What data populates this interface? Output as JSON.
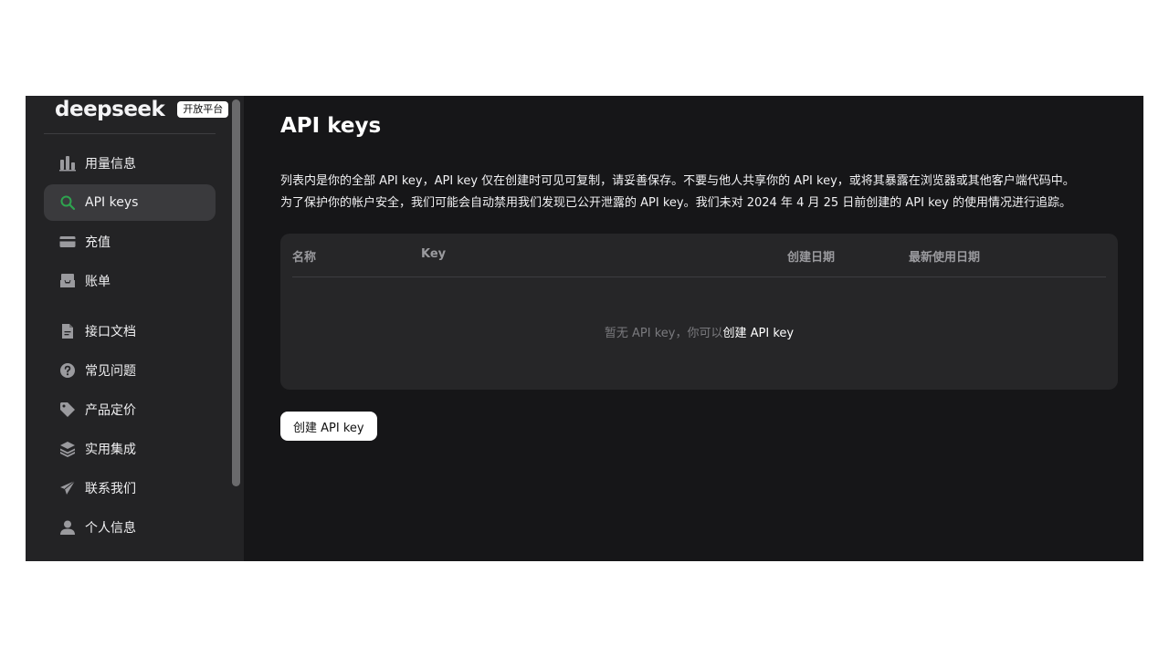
{
  "brand": {
    "logo": "deepseek",
    "badge": "开放平台"
  },
  "sidebar": {
    "items": [
      {
        "label": "用量信息",
        "icon": "bar-chart-icon"
      },
      {
        "label": "API keys",
        "icon": "search-icon",
        "active": true
      },
      {
        "label": "充值",
        "icon": "credit-card-icon"
      },
      {
        "label": "账单",
        "icon": "inbox-icon"
      },
      {
        "label": "接口文档",
        "icon": "document-icon"
      },
      {
        "label": "常见问题",
        "icon": "question-icon"
      },
      {
        "label": "产品定价",
        "icon": "tag-icon"
      },
      {
        "label": "实用集成",
        "icon": "layers-icon"
      },
      {
        "label": "联系我们",
        "icon": "send-icon"
      },
      {
        "label": "个人信息",
        "icon": "user-icon"
      }
    ]
  },
  "main": {
    "title": "API keys",
    "desc_line1": "列表内是你的全部 API key，API key 仅在创建时可见可复制，请妥善保存。不要与他人共享你的 API key，或将其暴露在浏览器或其他客户端代码中。",
    "desc_line2": "为了保护你的帐户安全，我们可能会自动禁用我们发现已公开泄露的 API key。我们未对 2024 年 4 月 25 日前创建的 API key 的使用情况进行追踪。",
    "table": {
      "columns": [
        "名称",
        "Key",
        "创建日期",
        "最新使用日期"
      ],
      "empty_text": "暂无 API key，你可以",
      "empty_link": "创建 API key"
    },
    "create_button": "创建 API key"
  },
  "colors": {
    "accent": "#2ea44f",
    "background": "#161618",
    "sidebar": "#232325"
  }
}
